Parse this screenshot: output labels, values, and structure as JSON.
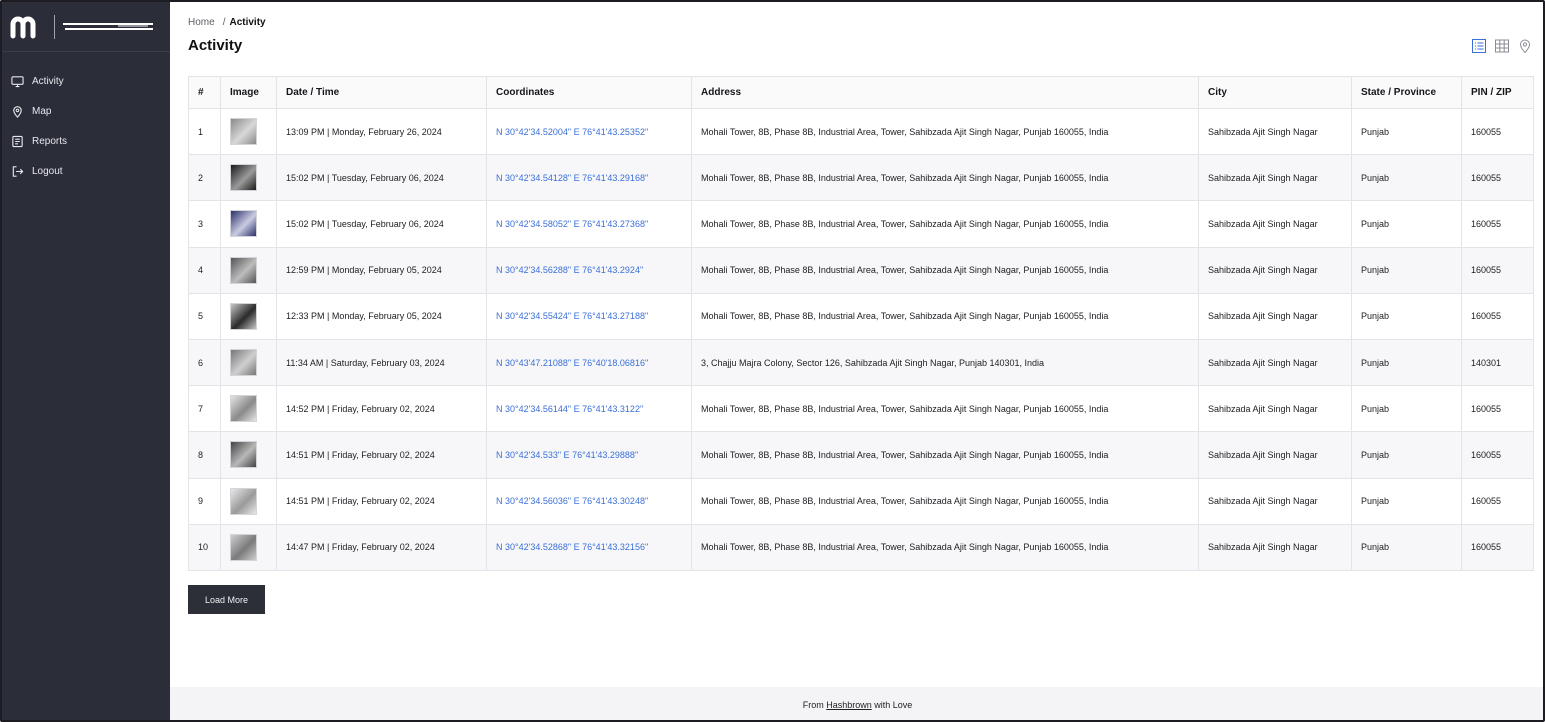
{
  "sidebar": {
    "items": [
      {
        "label": "Activity",
        "icon": "monitor-icon"
      },
      {
        "label": "Map",
        "icon": "map-pin-icon"
      },
      {
        "label": "Reports",
        "icon": "reports-icon"
      },
      {
        "label": "Logout",
        "icon": "logout-icon"
      }
    ]
  },
  "breadcrumb": {
    "home": "Home",
    "sep": "/",
    "current": "Activity"
  },
  "page": {
    "title": "Activity"
  },
  "table": {
    "headers": [
      "#",
      "Image",
      "Date / Time",
      "Coordinates",
      "Address",
      "City",
      "State / Province",
      "PIN / ZIP"
    ],
    "rows": [
      {
        "num": "1",
        "datetime": "13:09 PM | Monday, February 26, 2024",
        "coords": "N 30°42'34.52004\" E 76°41'43.25352\"",
        "address": "Mohali Tower, 8B, Phase 8B, Industrial Area, Tower, Sahibzada Ajit Singh Nagar, Punjab 160055, India",
        "city": "Sahibzada Ajit Singh Nagar",
        "state": "Punjab",
        "pin": "160055"
      },
      {
        "num": "2",
        "datetime": "15:02 PM | Tuesday, February 06, 2024",
        "coords": "N 30°42'34.54128\" E 76°41'43.29168\"",
        "address": "Mohali Tower, 8B, Phase 8B, Industrial Area, Tower, Sahibzada Ajit Singh Nagar, Punjab 160055, India",
        "city": "Sahibzada Ajit Singh Nagar",
        "state": "Punjab",
        "pin": "160055"
      },
      {
        "num": "3",
        "datetime": "15:02 PM | Tuesday, February 06, 2024",
        "coords": "N 30°42'34.58052\" E 76°41'43.27368\"",
        "address": "Mohali Tower, 8B, Phase 8B, Industrial Area, Tower, Sahibzada Ajit Singh Nagar, Punjab 160055, India",
        "city": "Sahibzada Ajit Singh Nagar",
        "state": "Punjab",
        "pin": "160055"
      },
      {
        "num": "4",
        "datetime": "12:59 PM | Monday, February 05, 2024",
        "coords": "N 30°42'34.56288\" E 76°41'43.2924\"",
        "address": "Mohali Tower, 8B, Phase 8B, Industrial Area, Tower, Sahibzada Ajit Singh Nagar, Punjab 160055, India",
        "city": "Sahibzada Ajit Singh Nagar",
        "state": "Punjab",
        "pin": "160055"
      },
      {
        "num": "5",
        "datetime": "12:33 PM | Monday, February 05, 2024",
        "coords": "N 30°42'34.55424\" E 76°41'43.27188\"",
        "address": "Mohali Tower, 8B, Phase 8B, Industrial Area, Tower, Sahibzada Ajit Singh Nagar, Punjab 160055, India",
        "city": "Sahibzada Ajit Singh Nagar",
        "state": "Punjab",
        "pin": "160055"
      },
      {
        "num": "6",
        "datetime": "11:34 AM | Saturday, February 03, 2024",
        "coords": "N 30°43'47.21088\" E 76°40'18.06816\"",
        "address": "3, Chajju Majra Colony, Sector 126, Sahibzada Ajit Singh Nagar, Punjab 140301, India",
        "city": "Sahibzada Ajit Singh Nagar",
        "state": "Punjab",
        "pin": "140301"
      },
      {
        "num": "7",
        "datetime": "14:52 PM | Friday, February 02, 2024",
        "coords": "N 30°42'34.56144\" E 76°41'43.3122\"",
        "address": "Mohali Tower, 8B, Phase 8B, Industrial Area, Tower, Sahibzada Ajit Singh Nagar, Punjab 160055, India",
        "city": "Sahibzada Ajit Singh Nagar",
        "state": "Punjab",
        "pin": "160055"
      },
      {
        "num": "8",
        "datetime": "14:51 PM | Friday, February 02, 2024",
        "coords": "N 30°42'34.533\" E 76°41'43.29888\"",
        "address": "Mohali Tower, 8B, Phase 8B, Industrial Area, Tower, Sahibzada Ajit Singh Nagar, Punjab 160055, India",
        "city": "Sahibzada Ajit Singh Nagar",
        "state": "Punjab",
        "pin": "160055"
      },
      {
        "num": "9",
        "datetime": "14:51 PM | Friday, February 02, 2024",
        "coords": "N 30°42'34.56036\" E 76°41'43.30248\"",
        "address": "Mohali Tower, 8B, Phase 8B, Industrial Area, Tower, Sahibzada Ajit Singh Nagar, Punjab 160055, India",
        "city": "Sahibzada Ajit Singh Nagar",
        "state": "Punjab",
        "pin": "160055"
      },
      {
        "num": "10",
        "datetime": "14:47 PM | Friday, February 02, 2024",
        "coords": "N 30°42'34.52868\" E 76°41'43.32156\"",
        "address": "Mohali Tower, 8B, Phase 8B, Industrial Area, Tower, Sahibzada Ajit Singh Nagar, Punjab 160055, India",
        "city": "Sahibzada Ajit Singh Nagar",
        "state": "Punjab",
        "pin": "160055"
      }
    ]
  },
  "load_more": {
    "label": "Load More"
  },
  "footer": {
    "prefix": "From",
    "link": "Hashbrown",
    "suffix": "with Love"
  },
  "colors": {
    "sidebar_bg": "#2b2d38",
    "link": "#3a6fd8",
    "button_bg": "#2c2e38"
  }
}
